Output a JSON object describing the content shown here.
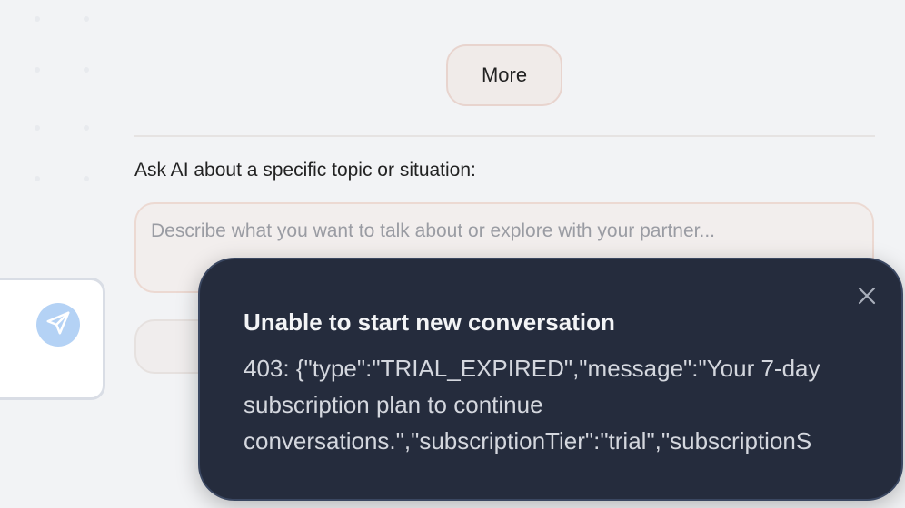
{
  "more_button": {
    "label": "More"
  },
  "ask": {
    "label": "Ask AI about a specific topic or situation:",
    "placeholder": "Describe what you want to talk about or explore with your partner...",
    "value": ""
  },
  "toast": {
    "title": "Unable to start new conversation",
    "lines": [
      "403: {\"type\":\"TRIAL_EXPIRED\",\"message\":\"Your 7-day",
      "subscription plan to continue",
      "conversations.\",\"subscriptionTier\":\"trial\",\"subscriptionS"
    ],
    "close_icon": "close-icon"
  },
  "send_icon": "paper-plane-icon",
  "colors": {
    "background": "#f2f3f5",
    "toast_bg": "#252c3d",
    "send_button": "#b4d2f5",
    "input_border": "#ecd9d2"
  }
}
